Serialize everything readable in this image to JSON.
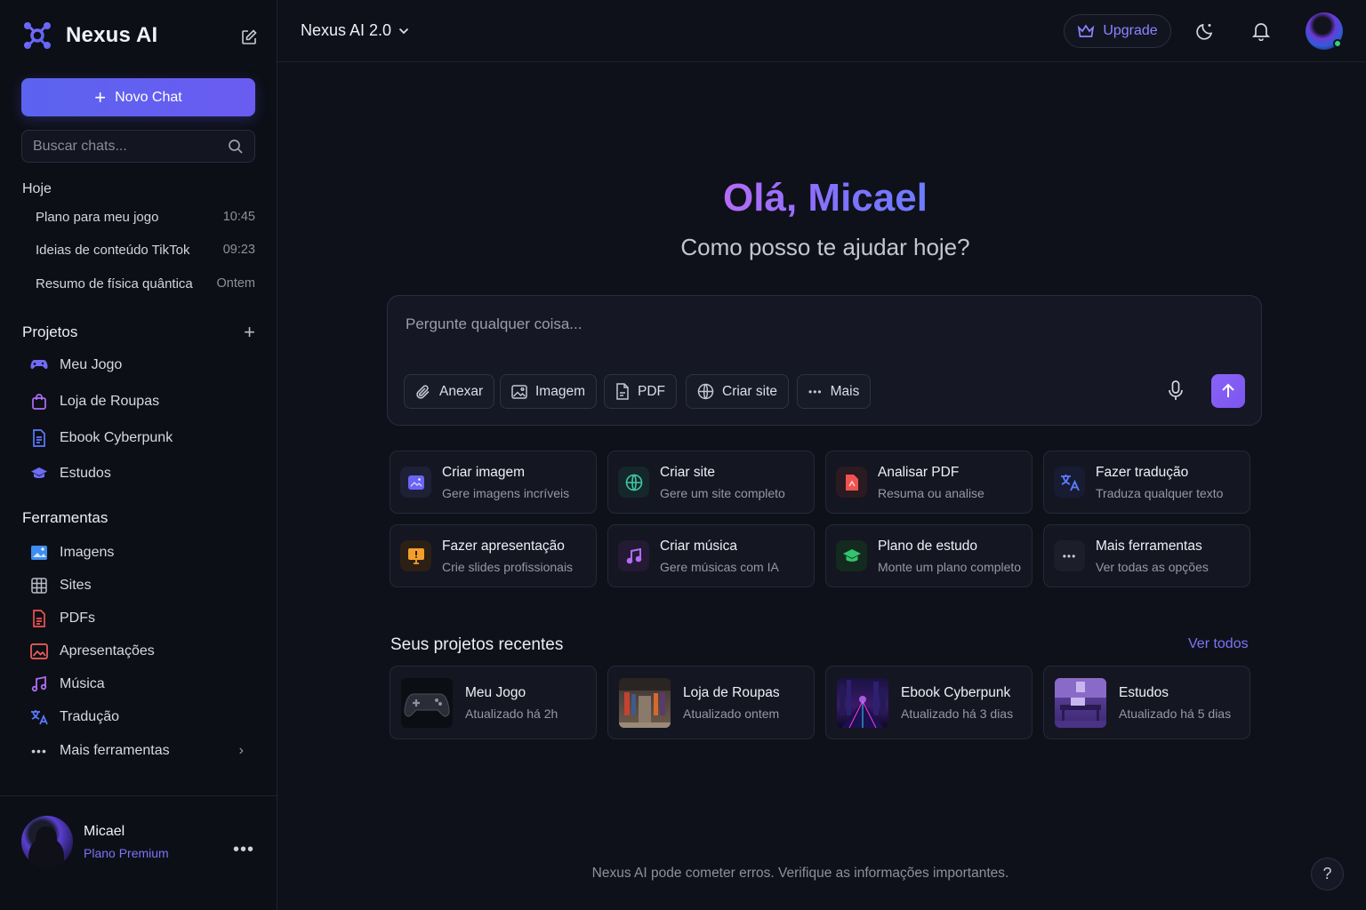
{
  "sidebar": {
    "brand": "Nexus AI",
    "new_chat": "Novo Chat",
    "search_placeholder": "Buscar chats...",
    "today_label": "Hoje",
    "history": [
      {
        "title": "Plano para meu jogo",
        "time": "10:45"
      },
      {
        "title": "Ideias de conteúdo TikTok",
        "time": "09:23"
      },
      {
        "title": "Resumo de física quântica",
        "time": "Ontem"
      }
    ],
    "projects_label": "Projetos",
    "projects": [
      {
        "label": "Meu Jogo",
        "icon": "gamepad-icon"
      },
      {
        "label": "Loja de Roupas",
        "icon": "shopping-bag-icon"
      },
      {
        "label": "Ebook Cyberpunk",
        "icon": "document-icon"
      },
      {
        "label": "Estudos",
        "icon": "graduation-cap-icon"
      }
    ],
    "tools_label": "Ferramentas",
    "tools": [
      {
        "label": "Imagens",
        "icon": "image-icon"
      },
      {
        "label": "Sites",
        "icon": "grid-icon"
      },
      {
        "label": "PDFs",
        "icon": "pdf-icon"
      },
      {
        "label": "Apresentações",
        "icon": "presentation-icon"
      },
      {
        "label": "Música",
        "icon": "music-icon"
      },
      {
        "label": "Tradução",
        "icon": "translate-icon"
      },
      {
        "label": "Mais ferramentas",
        "icon": "more-icon"
      }
    ],
    "user": {
      "name": "Micael",
      "plan": "Plano Premium"
    }
  },
  "topbar": {
    "model": "Nexus AI 2.0",
    "upgrade": "Upgrade"
  },
  "main": {
    "greeting": "Olá, Micael",
    "subtitle": "Como posso te ajudar hoje?",
    "composer": {
      "placeholder": "Pergunte qualquer coisa...",
      "chips": [
        "Anexar",
        "Imagem",
        "PDF",
        "Criar site",
        "Mais"
      ]
    },
    "quick_actions": [
      {
        "title": "Criar imagem",
        "desc": "Gere imagens incríveis",
        "icon": "image-icon",
        "color": "#6b63f5"
      },
      {
        "title": "Criar site",
        "desc": "Gere um site completo",
        "icon": "globe-icon",
        "color": "#3fc7a8"
      },
      {
        "title": "Analisar PDF",
        "desc": "Resuma ou analise",
        "icon": "pdf-icon",
        "color": "#ef5350"
      },
      {
        "title": "Fazer tradução",
        "desc": "Traduza qualquer texto",
        "icon": "translate-icon",
        "color": "#5b7cff"
      },
      {
        "title": "Fazer apresentação",
        "desc": "Crie slides profissionais",
        "icon": "presentation-icon",
        "color": "#f59e2c"
      },
      {
        "title": "Criar música",
        "desc": "Gere músicas com IA",
        "icon": "music-icon",
        "color": "#b06cf7"
      },
      {
        "title": "Plano de estudo",
        "desc": "Monte um plano completo",
        "icon": "graduation-cap-icon",
        "color": "#33c46f"
      },
      {
        "title": "Mais ferramentas",
        "desc": "Ver todas as opções",
        "icon": "more-icon",
        "color": "#c9cbd6"
      }
    ],
    "recent_title": "Seus projetos recentes",
    "see_all": "Ver todos",
    "recent": [
      {
        "title": "Meu Jogo",
        "updated": "Atualizado há 2h"
      },
      {
        "title": "Loja de Roupas",
        "updated": "Atualizado ontem"
      },
      {
        "title": "Ebook Cyberpunk",
        "updated": "Atualizado há 3 dias"
      },
      {
        "title": "Estudos",
        "updated": "Atualizado há 5 dias"
      }
    ],
    "footer": "Nexus AI pode cometer erros. Verifique as informações importantes.",
    "help": "?"
  }
}
